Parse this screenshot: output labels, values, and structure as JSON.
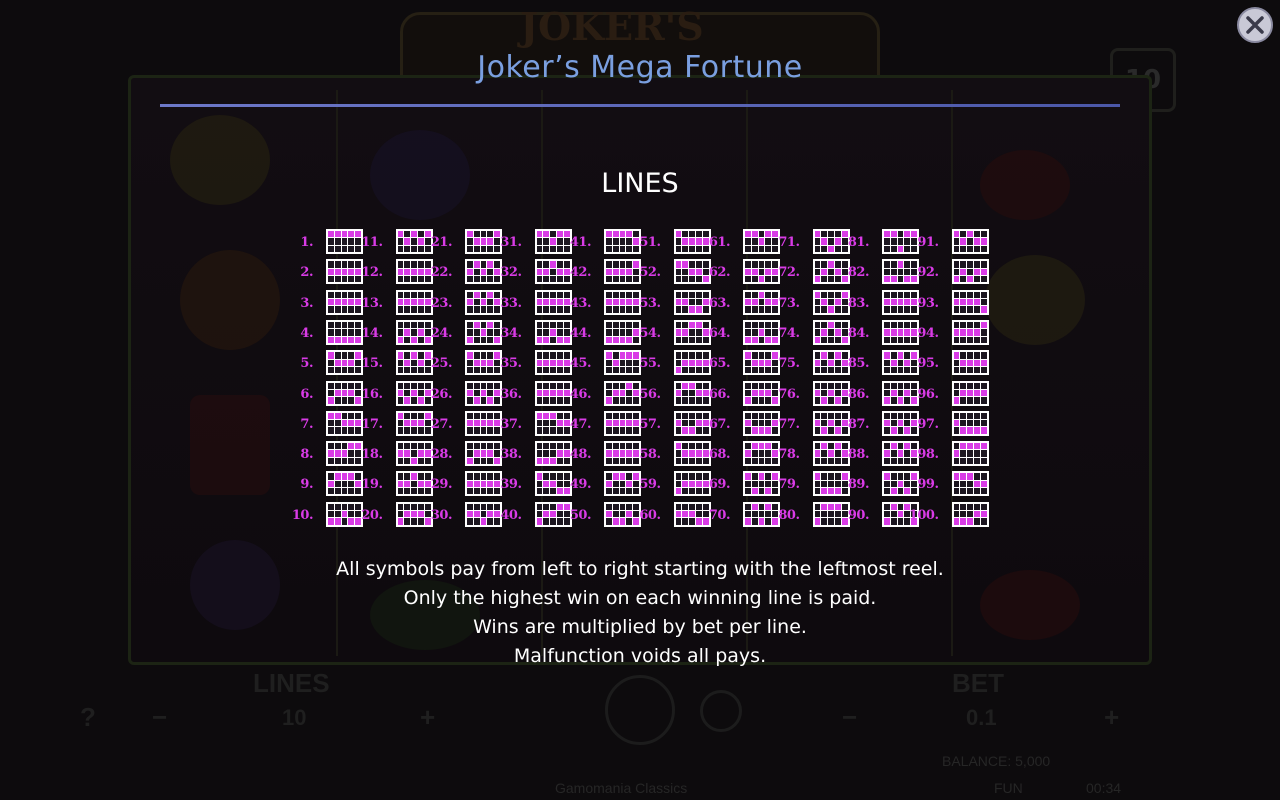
{
  "window": {
    "title": "Joker’s Mega Fortune",
    "close_icon": "close-icon"
  },
  "background": {
    "logo_text": "JOKER'S",
    "counter": "10",
    "lines_label": "LINES",
    "lines_value": "10",
    "bet_label": "BET",
    "bet_value": "0.1",
    "balance": "BALANCE: 5,000",
    "mode": "FUN",
    "clock": "00:34",
    "provider": "Gamomania Classics",
    "minus_left": "−",
    "plus_left": "+",
    "minus_right": "−",
    "plus_right": "+",
    "help": "?"
  },
  "section": {
    "heading": "LINES"
  },
  "paylines": {
    "columns": 10,
    "rows": 10,
    "labels": [
      "1.",
      "2.",
      "3.",
      "4.",
      "5.",
      "6.",
      "7.",
      "8.",
      "9.",
      "10.",
      "11.",
      "12.",
      "13.",
      "14.",
      "15.",
      "16.",
      "17.",
      "18.",
      "19.",
      "20.",
      "21.",
      "22.",
      "23.",
      "24.",
      "25.",
      "26.",
      "27.",
      "28.",
      "29.",
      "30.",
      "31.",
      "32.",
      "33.",
      "34.",
      "35.",
      "36.",
      "37.",
      "38.",
      "39.",
      "40.",
      "41.",
      "42.",
      "43.",
      "44.",
      "45.",
      "46.",
      "47.",
      "48.",
      "49.",
      "50.",
      "51.",
      "52.",
      "53.",
      "54.",
      "55.",
      "56.",
      "57.",
      "58.",
      "59.",
      "60.",
      "61.",
      "62.",
      "63.",
      "64.",
      "65.",
      "66.",
      "67.",
      "68.",
      "69.",
      "70.",
      "71.",
      "72.",
      "73.",
      "74.",
      "75.",
      "76.",
      "77.",
      "78.",
      "79.",
      "80.",
      "81.",
      "82.",
      "83.",
      "84.",
      "85.",
      "86.",
      "87.",
      "88.",
      "89.",
      "90.",
      "91.",
      "92.",
      "93.",
      "94.",
      "95.",
      "96.",
      "97.",
      "98.",
      "99.",
      "100."
    ],
    "patterns": [
      [
        0,
        0,
        0,
        0,
        0
      ],
      [
        1,
        1,
        1,
        1,
        1
      ],
      [
        2,
        2,
        2,
        2,
        2
      ],
      [
        3,
        3,
        3,
        3,
        3
      ],
      [
        0,
        1,
        1,
        1,
        0
      ],
      [
        3,
        2,
        2,
        2,
        3
      ],
      [
        0,
        0,
        1,
        2,
        2
      ],
      [
        2,
        2,
        1,
        0,
        0
      ],
      [
        1,
        0,
        0,
        0,
        1
      ],
      [
        3,
        3,
        2,
        3,
        3
      ],
      [
        0,
        1,
        0,
        1,
        0
      ],
      [
        1,
        2,
        1,
        2,
        1
      ],
      [
        2,
        1,
        2,
        1,
        2
      ],
      [
        3,
        2,
        3,
        2,
        3
      ],
      [
        0,
        2,
        0,
        2,
        0
      ],
      [
        1,
        3,
        1,
        3,
        1
      ],
      [
        0,
        1,
        2,
        1,
        0
      ],
      [
        1,
        2,
        3,
        2,
        1
      ],
      [
        2,
        1,
        0,
        1,
        2
      ],
      [
        3,
        2,
        1,
        2,
        3
      ],
      [
        0,
        1,
        1,
        1,
        0
      ],
      [
        1,
        0,
        1,
        0,
        1
      ],
      [
        2,
        0,
        1,
        0,
        2
      ],
      [
        3,
        0,
        1,
        0,
        3
      ],
      [
        0,
        2,
        1,
        2,
        0
      ],
      [
        1,
        3,
        2,
        3,
        1
      ],
      [
        2,
        1,
        1,
        1,
        2
      ],
      [
        3,
        1,
        1,
        1,
        3
      ],
      [
        1,
        1,
        2,
        1,
        1
      ],
      [
        2,
        2,
        3,
        2,
        2
      ],
      [
        0,
        0,
        1,
        0,
        0
      ],
      [
        1,
        1,
        0,
        1,
        1
      ],
      [
        2,
        2,
        1,
        2,
        2
      ],
      [
        3,
        3,
        2,
        3,
        3
      ],
      [
        1,
        1,
        1,
        2,
        2
      ],
      [
        2,
        2,
        2,
        1,
        1
      ],
      [
        0,
        0,
        0,
        1,
        1
      ],
      [
        3,
        3,
        3,
        2,
        2
      ],
      [
        0,
        1,
        2,
        3,
        3
      ],
      [
        3,
        2,
        1,
        0,
        0
      ],
      [
        0,
        0,
        0,
        0,
        1
      ],
      [
        1,
        1,
        1,
        1,
        0
      ],
      [
        2,
        2,
        2,
        2,
        1
      ],
      [
        3,
        3,
        3,
        3,
        2
      ],
      [
        0,
        1,
        0,
        0,
        0
      ],
      [
        3,
        2,
        1,
        0,
        1
      ],
      [
        1,
        2,
        2,
        2,
        1
      ],
      [
        2,
        1,
        1,
        1,
        2
      ],
      [
        1,
        0,
        0,
        1,
        0
      ],
      [
        2,
        3,
        3,
        2,
        3
      ],
      [
        0,
        1,
        2,
        2,
        1
      ],
      [
        0,
        0,
        1,
        2,
        3
      ],
      [
        1,
        2,
        3,
        3,
        2
      ],
      [
        2,
        1,
        0,
        0,
        1
      ],
      [
        3,
        2,
        1,
        1,
        2
      ],
      [
        1,
        0,
        0,
        1,
        2
      ],
      [
        2,
        3,
        3,
        2,
        1
      ],
      [
        0,
        1,
        1,
        2,
        2
      ],
      [
        3,
        2,
        2,
        1,
        1
      ],
      [
        1,
        2,
        2,
        3,
        3
      ],
      [
        0,
        0,
        2,
        0,
        0
      ],
      [
        1,
        1,
        3,
        1,
        1
      ],
      [
        2,
        2,
        0,
        2,
        2
      ],
      [
        3,
        3,
        1,
        3,
        3
      ],
      [
        0,
        2,
        2,
        2,
        0
      ],
      [
        3,
        1,
        1,
        1,
        3
      ],
      [
        1,
        3,
        3,
        3,
        1
      ],
      [
        2,
        0,
        0,
        0,
        2
      ],
      [
        0,
        3,
        0,
        3,
        0
      ],
      [
        3,
        0,
        3,
        0,
        3
      ],
      [
        0,
        1,
        3,
        1,
        0
      ],
      [
        3,
        2,
        0,
        2,
        3
      ],
      [
        0,
        2,
        3,
        2,
        0
      ],
      [
        3,
        1,
        0,
        1,
        3
      ],
      [
        1,
        0,
        2,
        0,
        1
      ],
      [
        2,
        3,
        1,
        3,
        2
      ],
      [
        1,
        3,
        2,
        3,
        1
      ],
      [
        2,
        0,
        1,
        0,
        2
      ],
      [
        0,
        3,
        3,
        3,
        0
      ],
      [
        3,
        0,
        0,
        0,
        3
      ],
      [
        0,
        0,
        3,
        0,
        0
      ],
      [
        3,
        3,
        0,
        3,
        3
      ],
      [
        1,
        1,
        2,
        1,
        1
      ],
      [
        2,
        2,
        1,
        2,
        2
      ],
      [
        0,
        2,
        0,
        2,
        0
      ],
      [
        3,
        1,
        3,
        1,
        3
      ],
      [
        1,
        3,
        1,
        3,
        1
      ],
      [
        2,
        0,
        2,
        0,
        2
      ],
      [
        0,
        3,
        1,
        3,
        0
      ],
      [
        3,
        0,
        2,
        0,
        3
      ],
      [
        0,
        1,
        0,
        1,
        2
      ],
      [
        3,
        2,
        3,
        2,
        1
      ],
      [
        1,
        2,
        1,
        2,
        3
      ],
      [
        2,
        1,
        2,
        1,
        0
      ],
      [
        0,
        2,
        2,
        2,
        2
      ],
      [
        3,
        1,
        1,
        1,
        1
      ],
      [
        1,
        3,
        3,
        3,
        3
      ],
      [
        2,
        0,
        0,
        0,
        0
      ],
      [
        0,
        0,
        0,
        2,
        2
      ],
      [
        3,
        3,
        3,
        1,
        1
      ]
    ]
  },
  "rules": [
    "All symbols pay from left to right starting with the leftmost reel.",
    "Only the highest win on each winning line is paid.",
    "Wins are multiplied by bet per line.",
    "Malfunction voids all pays."
  ],
  "colors": {
    "accent": "#d93be6",
    "title": "#7a9fe0",
    "rule_line": "#6d78c9"
  }
}
